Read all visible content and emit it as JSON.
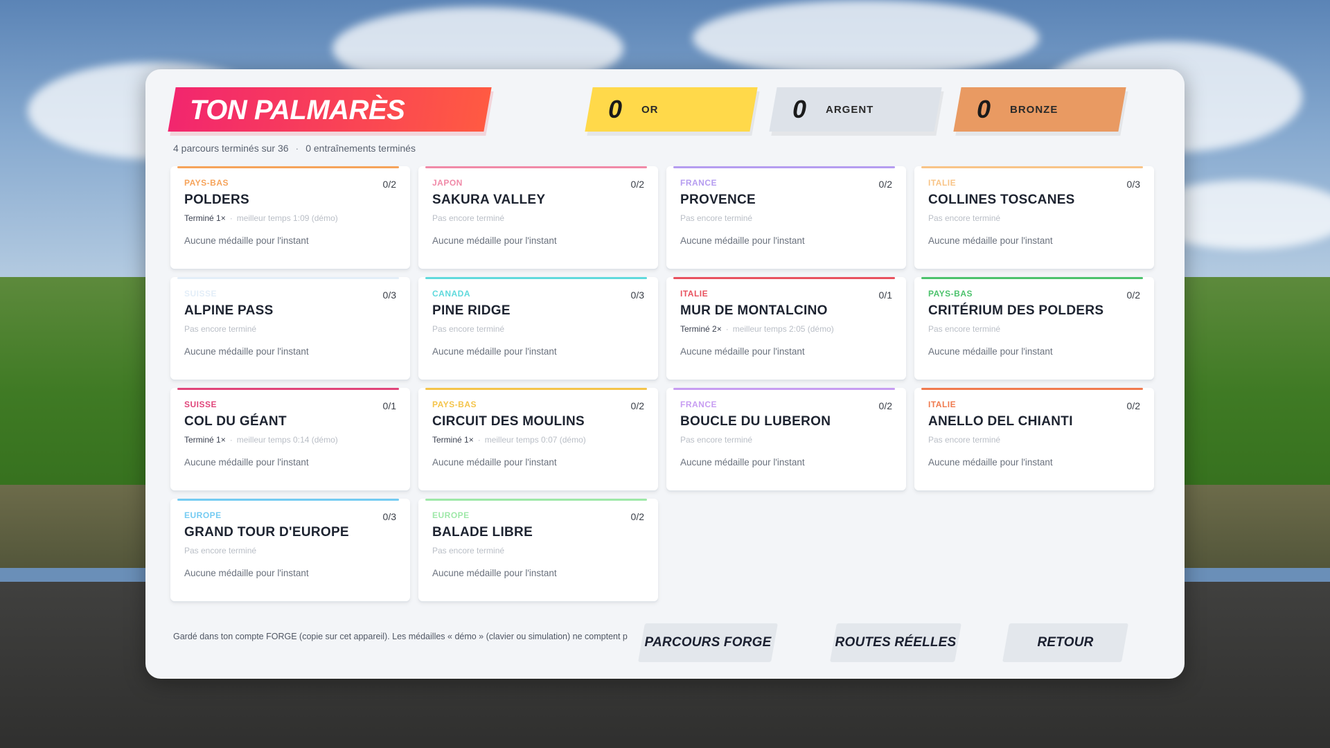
{
  "header": {
    "title": "TON PALMARÈS",
    "summary_courses": "4 parcours terminés sur 36",
    "summary_training": "0 entraînements terminés"
  },
  "medals": [
    {
      "count": "0",
      "label": "OR",
      "color": "#ffd94a"
    },
    {
      "count": "0",
      "label": "ARGENT",
      "color": "#dde2e9"
    },
    {
      "count": "0",
      "label": "BRONZE",
      "color": "#e99a62"
    }
  ],
  "cards": [
    {
      "country": "PAYS-BAS",
      "name": "POLDERS",
      "count": "0/2",
      "accent": "#f6a35a",
      "status_done": "Terminé 1×",
      "status_best": "meilleur temps 1:09 (démo)",
      "status_none": "",
      "medal_text": "Aucune médaille pour l'instant"
    },
    {
      "country": "JAPON",
      "name": "SAKURA VALLEY",
      "count": "0/2",
      "accent": "#f08aa8",
      "status_done": "",
      "status_best": "",
      "status_none": "Pas encore terminé",
      "medal_text": "Aucune médaille pour l'instant"
    },
    {
      "country": "FRANCE",
      "name": "PROVENCE",
      "count": "0/2",
      "accent": "#b59cf0",
      "status_done": "",
      "status_best": "",
      "status_none": "Pas encore terminé",
      "medal_text": "Aucune médaille pour l'instant"
    },
    {
      "country": "ITALIE",
      "name": "COLLINES TOSCANES",
      "count": "0/3",
      "accent": "#f8c487",
      "status_done": "",
      "status_best": "",
      "status_none": "Pas encore terminé",
      "medal_text": "Aucune médaille pour l'instant"
    },
    {
      "country": "SUISSE",
      "name": "ALPINE PASS",
      "count": "0/3",
      "accent": "#e3eef8",
      "status_done": "",
      "status_best": "",
      "status_none": "Pas encore terminé",
      "medal_text": "Aucune médaille pour l'instant"
    },
    {
      "country": "CANADA",
      "name": "PINE RIDGE",
      "count": "0/3",
      "accent": "#5fd9dc",
      "status_done": "",
      "status_best": "",
      "status_none": "Pas encore terminé",
      "medal_text": "Aucune médaille pour l'instant"
    },
    {
      "country": "ITALIE",
      "name": "MUR DE MONTALCINO",
      "count": "0/1",
      "accent": "#e8515e",
      "status_done": "Terminé 2×",
      "status_best": "meilleur temps 2:05 (démo)",
      "status_none": "",
      "medal_text": "Aucune médaille pour l'instant"
    },
    {
      "country": "PAYS-BAS",
      "name": "CRITÉRIUM DES POLDERS",
      "count": "0/2",
      "accent": "#4cc26c",
      "status_done": "",
      "status_best": "",
      "status_none": "Pas encore terminé",
      "medal_text": "Aucune médaille pour l'instant"
    },
    {
      "country": "SUISSE",
      "name": "COL DU GÉANT",
      "count": "0/1",
      "accent": "#e0457a",
      "status_done": "Terminé 1×",
      "status_best": "meilleur temps 0:14 (démo)",
      "status_none": "",
      "medal_text": "Aucune médaille pour l'instant"
    },
    {
      "country": "PAYS-BAS",
      "name": "CIRCUIT DES MOULINS",
      "count": "0/2",
      "accent": "#f4c44a",
      "status_done": "Terminé 1×",
      "status_best": "meilleur temps 0:07 (démo)",
      "status_none": "",
      "medal_text": "Aucune médaille pour l'instant"
    },
    {
      "country": "FRANCE",
      "name": "BOUCLE DU LUBERON",
      "count": "0/2",
      "accent": "#c79cf2",
      "status_done": "",
      "status_best": "",
      "status_none": "Pas encore terminé",
      "medal_text": "Aucune médaille pour l'instant"
    },
    {
      "country": "ITALIE",
      "name": "ANELLO DEL CHIANTI",
      "count": "0/2",
      "accent": "#f07a4e",
      "status_done": "",
      "status_best": "",
      "status_none": "Pas encore terminé",
      "medal_text": "Aucune médaille pour l'instant"
    },
    {
      "country": "EUROPE",
      "name": "GRAND TOUR D'EUROPE",
      "count": "0/3",
      "accent": "#74cbf2",
      "status_done": "",
      "status_best": "",
      "status_none": "Pas encore terminé",
      "medal_text": "Aucune médaille pour l'instant"
    },
    {
      "country": "EUROPE",
      "name": "BALADE LIBRE",
      "count": "0/2",
      "accent": "#9ee8a8",
      "status_done": "",
      "status_best": "",
      "status_none": "Pas encore terminé",
      "medal_text": "Aucune médaille pour l'instant"
    }
  ],
  "footer": {
    "note": "Gardé dans ton compte FORGE (copie sur cet appareil). Les médailles « démo » (clavier ou simulation) ne comptent p",
    "buttons": {
      "forge": "PARCOURS FORGE",
      "real": "ROUTES RÉELLES",
      "back": "RETOUR"
    }
  }
}
